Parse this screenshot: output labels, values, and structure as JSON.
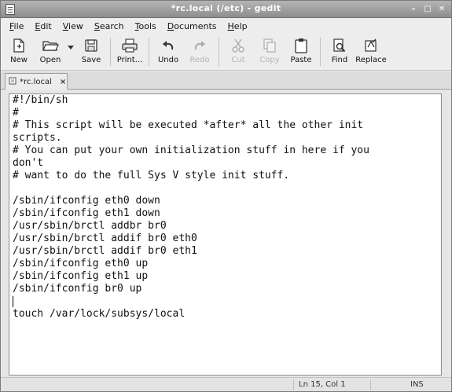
{
  "window": {
    "title": "*rc.local (/etc) - gedit"
  },
  "menubar": {
    "items": [
      {
        "label": "File",
        "mnemonic": "F",
        "rest": "ile"
      },
      {
        "label": "Edit",
        "mnemonic": "E",
        "rest": "dit"
      },
      {
        "label": "View",
        "mnemonic": "V",
        "rest": "iew"
      },
      {
        "label": "Search",
        "mnemonic": "S",
        "rest": "earch"
      },
      {
        "label": "Tools",
        "mnemonic": "T",
        "rest": "ools"
      },
      {
        "label": "Documents",
        "mnemonic": "D",
        "rest": "ocuments"
      },
      {
        "label": "Help",
        "mnemonic": "H",
        "rest": "elp"
      }
    ]
  },
  "toolbar": {
    "new": "New",
    "open": "Open",
    "save": "Save",
    "print": "Print...",
    "undo": "Undo",
    "redo": "Redo",
    "cut": "Cut",
    "copy": "Copy",
    "paste": "Paste",
    "find": "Find",
    "replace": "Replace"
  },
  "tab": {
    "label": "*rc.local"
  },
  "editor": {
    "lines": [
      "#!/bin/sh",
      "#",
      "# This script will be executed *after* all the other init",
      "scripts.",
      "# You can put your own initialization stuff in here if you",
      "don't",
      "# want to do the full Sys V style init stuff.",
      "",
      "/sbin/ifconfig eth0 down",
      "/sbin/ifconfig eth1 down",
      "/usr/sbin/brctl addbr br0",
      "/usr/sbin/brctl addif br0 eth0",
      "/usr/sbin/brctl addif br0 eth1",
      "/sbin/ifconfig eth0 up",
      "/sbin/ifconfig eth1 up",
      "/sbin/ifconfig br0 up",
      "",
      "touch /var/lock/subsys/local"
    ]
  },
  "statusbar": {
    "position": "Ln 15, Col 1",
    "mode": "INS"
  }
}
